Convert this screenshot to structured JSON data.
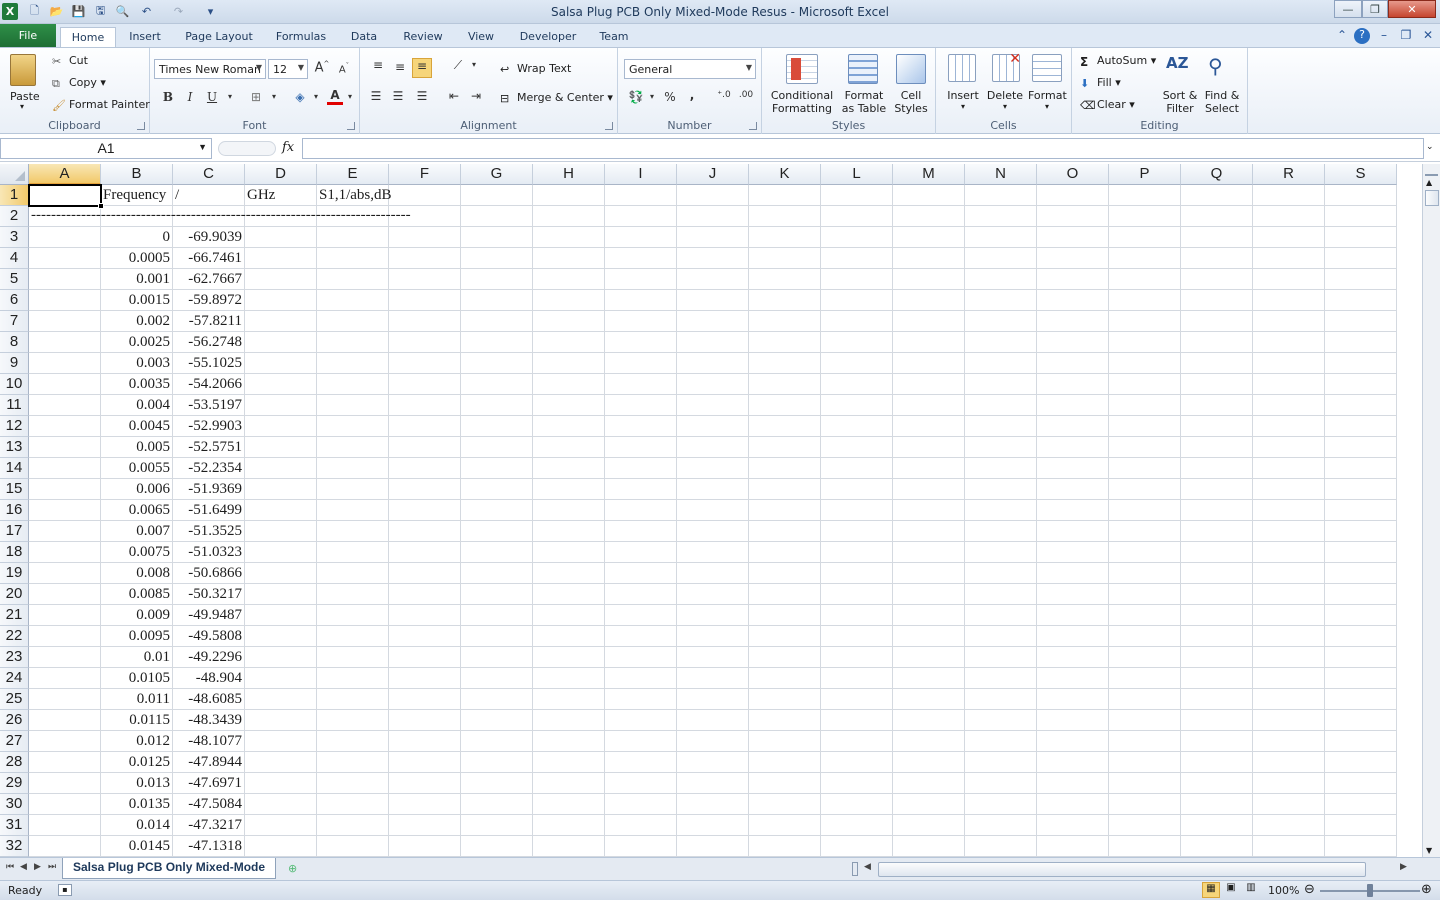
{
  "window": {
    "title": "Salsa Plug PCB Only Mixed-Mode Resus  -  Microsoft Excel",
    "logo_letter": "X",
    "minimize": "—",
    "restore": "❐",
    "close": "✕"
  },
  "tabs": [
    {
      "label": "File"
    },
    {
      "label": "Home"
    },
    {
      "label": "Insert"
    },
    {
      "label": "Page Layout"
    },
    {
      "label": "Formulas"
    },
    {
      "label": "Data"
    },
    {
      "label": "Review"
    },
    {
      "label": "View"
    },
    {
      "label": "Developer"
    },
    {
      "label": "Team"
    }
  ],
  "ribbon": {
    "clipboard": {
      "label": "Clipboard",
      "paste": "Paste",
      "cut": "Cut",
      "copy": "Copy",
      "format_painter": "Format Painter"
    },
    "font": {
      "label": "Font",
      "name": "Times New Roman",
      "size": "12",
      "bold": "B",
      "italic": "I",
      "underline": "U",
      "font_color": "#e00000"
    },
    "alignment": {
      "label": "Alignment",
      "wrap_text": "Wrap Text",
      "merge_center": "Merge & Center"
    },
    "number": {
      "label": "Number",
      "format": "General",
      "percent": "%",
      "comma": ","
    },
    "styles": {
      "label": "Styles",
      "conditional_1": "Conditional",
      "conditional_2": "Formatting",
      "format_table_1": "Format",
      "format_table_2": "as Table",
      "cell_styles_1": "Cell",
      "cell_styles_2": "Styles"
    },
    "cells": {
      "label": "Cells",
      "insert": "Insert",
      "delete": "Delete",
      "format": "Format"
    },
    "editing": {
      "label": "Editing",
      "autosum": "AutoSum",
      "fill": "Fill",
      "clear": "Clear",
      "sort_1": "Sort &",
      "sort_2": "Filter",
      "find_1": "Find &",
      "find_2": "Select"
    }
  },
  "formula_bar": {
    "name_box": "A1",
    "fx": "fx",
    "value": ""
  },
  "columns": [
    "A",
    "B",
    "C",
    "D",
    "E",
    "F",
    "G",
    "H",
    "I",
    "J",
    "K",
    "L",
    "M",
    "N",
    "O",
    "P",
    "Q",
    "R",
    "S"
  ],
  "selected_column": "A",
  "selected_row": "1",
  "rows": [
    "1",
    "2",
    "3",
    "4",
    "5",
    "6",
    "7",
    "8",
    "9",
    "10",
    "11",
    "12",
    "13",
    "14",
    "15",
    "16",
    "17",
    "18",
    "19",
    "20",
    "21",
    "22",
    "23",
    "24",
    "25",
    "26",
    "27",
    "28",
    "29",
    "30",
    "31",
    "32"
  ],
  "header_row": {
    "b": "Frequency",
    "c": "/",
    "d": "GHz",
    "e": "S1,1/abs,dB"
  },
  "separator": "----------------------------------------------------------------------------",
  "data_rows": [
    {
      "b": "0",
      "c": "-69.9039"
    },
    {
      "b": "0.0005",
      "c": "-66.7461"
    },
    {
      "b": "0.001",
      "c": "-62.7667"
    },
    {
      "b": "0.0015",
      "c": "-59.8972"
    },
    {
      "b": "0.002",
      "c": "-57.8211"
    },
    {
      "b": "0.0025",
      "c": "-56.2748"
    },
    {
      "b": "0.003",
      "c": "-55.1025"
    },
    {
      "b": "0.0035",
      "c": "-54.2066"
    },
    {
      "b": "0.004",
      "c": "-53.5197"
    },
    {
      "b": "0.0045",
      "c": "-52.9903"
    },
    {
      "b": "0.005",
      "c": "-52.5751"
    },
    {
      "b": "0.0055",
      "c": "-52.2354"
    },
    {
      "b": "0.006",
      "c": "-51.9369"
    },
    {
      "b": "0.0065",
      "c": "-51.6499"
    },
    {
      "b": "0.007",
      "c": "-51.3525"
    },
    {
      "b": "0.0075",
      "c": "-51.0323"
    },
    {
      "b": "0.008",
      "c": "-50.6866"
    },
    {
      "b": "0.0085",
      "c": "-50.3217"
    },
    {
      "b": "0.009",
      "c": "-49.9487"
    },
    {
      "b": "0.0095",
      "c": "-49.5808"
    },
    {
      "b": "0.01",
      "c": "-49.2296"
    },
    {
      "b": "0.0105",
      "c": "-48.904"
    },
    {
      "b": "0.011",
      "c": "-48.6085"
    },
    {
      "b": "0.0115",
      "c": "-48.3439"
    },
    {
      "b": "0.012",
      "c": "-48.1077"
    },
    {
      "b": "0.0125",
      "c": "-47.8944"
    },
    {
      "b": "0.013",
      "c": "-47.6971"
    },
    {
      "b": "0.0135",
      "c": "-47.5084"
    },
    {
      "b": "0.014",
      "c": "-47.3217"
    },
    {
      "b": "0.0145",
      "c": "-47.1318"
    }
  ],
  "sheet": {
    "tab": "Salsa Plug PCB Only Mixed-Mode"
  },
  "status": {
    "ready": "Ready",
    "zoom": "100%"
  }
}
